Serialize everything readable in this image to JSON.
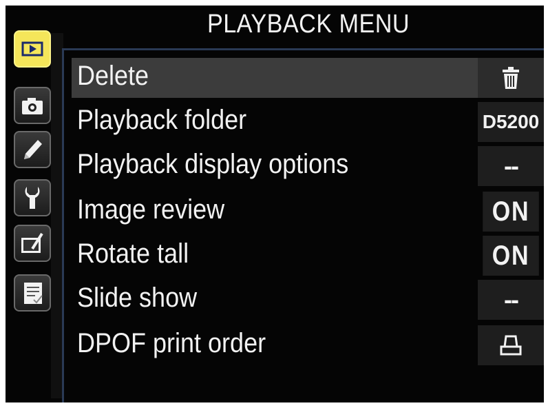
{
  "menu": {
    "title": "PLAYBACK MENU",
    "tabs": [
      {
        "icon": "playback-icon",
        "active": true
      },
      {
        "icon": "camera-icon",
        "active": false
      },
      {
        "icon": "pencil-icon",
        "active": false
      },
      {
        "icon": "wrench-icon",
        "active": false
      },
      {
        "icon": "retouch-icon",
        "active": false
      },
      {
        "icon": "recent-settings-icon",
        "active": false
      }
    ],
    "items": [
      {
        "label": "Delete",
        "value_icon": "trash-icon"
      },
      {
        "label": "Playback folder",
        "value": "D5200"
      },
      {
        "label": "Playback display options",
        "value": "--"
      },
      {
        "label": "Image review",
        "value": "ON"
      },
      {
        "label": "Rotate tall",
        "value": "ON"
      },
      {
        "label": "Slide show",
        "value": "--"
      },
      {
        "label": "DPOF print order",
        "value_icon": "printer-icon"
      }
    ],
    "colors": {
      "active_tab": "#f5e65a",
      "selected_row": "#3c3c3c",
      "accent_line": "#2a3a55"
    }
  }
}
